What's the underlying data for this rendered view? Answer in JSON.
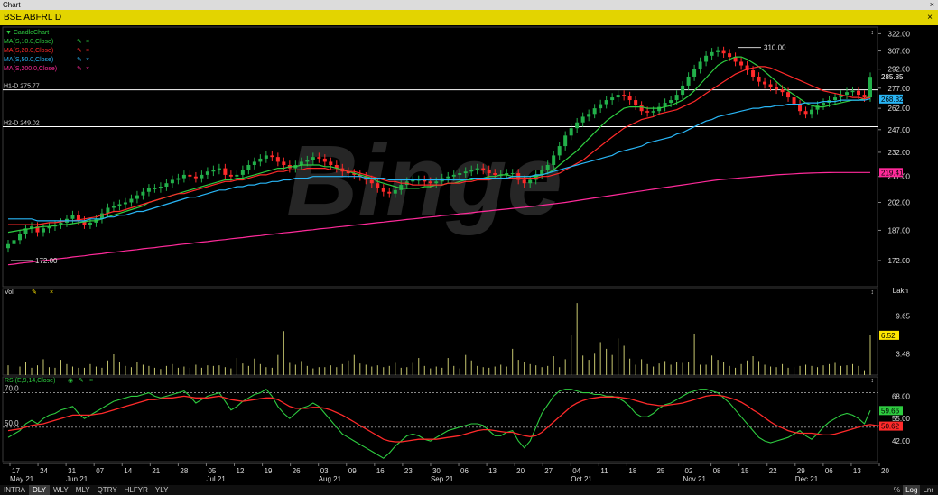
{
  "window": {
    "title": "Chart",
    "close_glyph": "×"
  },
  "symbol_bar": {
    "title": "BSE ABFRL D",
    "close_glyph": "×"
  },
  "legend": {
    "candle": "CandleChart",
    "ma": [
      {
        "label": "MA(S,10.0,Close)",
        "color": "#2ecc40"
      },
      {
        "label": "MA(S,20.0,Close)",
        "color": "#ff2a2a"
      },
      {
        "label": "MA(S,50.0,Close)",
        "color": "#29b6f6"
      },
      {
        "label": "MA(S,200.0,Close)",
        "color": "#ff2a9a"
      }
    ],
    "vol": "Vol",
    "rsi": "RSI(E,9,14,Close)"
  },
  "horizontal_lines": [
    {
      "label": "H1-D 275.77",
      "value": 275.77
    },
    {
      "label": "H2-D 249.02",
      "value": 249.02
    }
  ],
  "annotations": [
    {
      "label": "172.00",
      "value": 172.0
    },
    {
      "label": "310.00",
      "value": 310.0
    }
  ],
  "price_badges": [
    {
      "label": "285.85",
      "value": 285.85,
      "bg": "#000000",
      "fg": "#ffffff"
    },
    {
      "label": "268.82",
      "value": 268.82,
      "bg": "#29b6f6",
      "fg": "#000000"
    },
    {
      "label": "219.41",
      "value": 219.41,
      "bg": "#ff2a9a",
      "fg": "#000000"
    }
  ],
  "volume_unit": "Lakh",
  "volume_badge": {
    "label": "6.52",
    "value": 6.52
  },
  "rsi_badges": [
    {
      "label": "59.66",
      "value": 59.66,
      "bg": "#2ecc40"
    },
    {
      "label": "50.62",
      "value": 50.62,
      "bg": "#ff2a2a"
    }
  ],
  "colors": {
    "up": "#22b04a",
    "down": "#ff2a2a",
    "volume": "#c8c870",
    "watermark": "#262626"
  },
  "timeframes": [
    "INTRA",
    "DLY",
    "WLY",
    "MLY",
    "QTRY",
    "HLFYR",
    "YLY"
  ],
  "active_timeframe": "DLY",
  "scale_toggles": [
    "%",
    "Log",
    "Lnr"
  ],
  "active_scale": "Log",
  "watermark": "Binge",
  "chart_data": {
    "type": "candlestick",
    "title": "BSE ABFRL D",
    "price_axis": {
      "ticks": [
        172.0,
        187.0,
        202.0,
        217.0,
        232.0,
        247.0,
        262.0,
        277.0,
        292.0,
        307.0,
        322.0
      ],
      "ylim": [
        160,
        328
      ],
      "scale": "log"
    },
    "volume_axis": {
      "ticks": [
        3.48,
        9.65
      ],
      "unit": "Lakh",
      "ylim": [
        0,
        13
      ]
    },
    "rsi_axis": {
      "ticks": [
        42.0,
        55.0,
        68.0
      ],
      "ref_lines": [
        70.0,
        50.0
      ],
      "ylim": [
        30,
        75
      ]
    },
    "x_ticks": [
      "17",
      "24",
      "31",
      "07",
      "14",
      "21",
      "28",
      "05",
      "12",
      "19",
      "26",
      "03",
      "09",
      "16",
      "23",
      "30",
      "06",
      "13",
      "20",
      "27",
      "04",
      "11",
      "18",
      "25",
      "02",
      "08",
      "15",
      "22",
      "29",
      "06",
      "13",
      "20"
    ],
    "month_labels": [
      "May 21",
      "Jun 21",
      "Jul 21",
      "Aug 21",
      "Sep 21",
      "Oct 21",
      "Nov 21",
      "Dec 21"
    ],
    "month_tick_index": [
      0,
      2,
      7,
      11,
      15,
      20,
      24,
      28
    ],
    "closes": [
      180,
      182,
      185,
      188,
      189,
      186,
      188,
      189,
      190,
      191,
      193,
      195,
      192,
      190,
      191,
      193,
      196,
      199,
      200,
      201,
      202,
      204,
      206,
      208,
      210,
      210,
      211,
      213,
      215,
      216,
      218,
      217,
      216,
      218,
      220,
      221,
      222,
      218,
      217,
      218,
      221,
      224,
      226,
      228,
      230,
      229,
      226,
      224,
      222,
      224,
      226,
      227,
      229,
      228,
      226,
      224,
      222,
      220,
      219,
      218,
      217,
      215,
      213,
      210,
      208,
      207,
      209,
      212,
      214,
      215,
      215,
      214,
      213,
      214,
      216,
      217,
      218,
      219,
      220,
      221,
      222,
      221,
      219,
      218,
      218,
      219,
      219,
      215,
      213,
      215,
      218,
      221,
      224,
      230,
      236,
      243,
      248,
      252,
      256,
      258,
      262,
      265,
      268,
      270,
      272,
      271,
      268,
      264,
      260,
      259,
      260,
      263,
      266,
      268,
      272,
      279,
      286,
      292,
      298,
      303,
      306,
      307,
      305,
      302,
      298,
      295,
      291,
      286,
      282,
      280,
      278,
      276,
      274,
      270,
      265,
      260,
      258,
      261,
      264,
      266,
      268,
      270,
      272,
      274,
      275,
      272,
      270,
      285.85
    ],
    "ma10": [
      186,
      186.5,
      187,
      187.5,
      188,
      188.5,
      189,
      189,
      189.5,
      190,
      190,
      190.5,
      191,
      191.5,
      192,
      192,
      193,
      194,
      195,
      196,
      197,
      198,
      199,
      200,
      202,
      203,
      204,
      205,
      206,
      207,
      208,
      209,
      210,
      211,
      212,
      213,
      214,
      215,
      215,
      216,
      216,
      217,
      218,
      219,
      220,
      221,
      222,
      222,
      223,
      223,
      224,
      224,
      224,
      224,
      223,
      223,
      222,
      221,
      220,
      219,
      218,
      217,
      216,
      214,
      213,
      212,
      211,
      210,
      210,
      210,
      210,
      211,
      211,
      212,
      212,
      213,
      213,
      214,
      215,
      215,
      216,
      216,
      217,
      217,
      218,
      218,
      217,
      217,
      217,
      217,
      217,
      218,
      219,
      221,
      224,
      227,
      230,
      233,
      237,
      241,
      245,
      249,
      253,
      256,
      259,
      262,
      263,
      263,
      263,
      262,
      262,
      262,
      263,
      264,
      266,
      268,
      271,
      275,
      280,
      285,
      290,
      295,
      298,
      300,
      302,
      302,
      300,
      297,
      294,
      290,
      286,
      282,
      278,
      275,
      272,
      269,
      266,
      264,
      263,
      263,
      264,
      265,
      266,
      267,
      268,
      268,
      269,
      271
    ],
    "ma20": [
      190,
      190,
      190,
      190,
      190,
      190,
      190.5,
      191,
      191,
      191.5,
      192,
      192,
      192.5,
      193,
      193.5,
      194,
      195,
      196,
      197,
      197,
      198,
      199,
      200,
      201,
      202,
      203,
      204,
      205,
      206,
      207,
      207,
      208,
      209,
      210,
      211,
      212,
      213,
      214,
      214,
      215,
      215,
      216,
      217,
      218,
      218,
      219,
      220,
      220,
      221,
      221,
      221,
      222,
      222,
      222,
      222,
      221,
      221,
      221,
      220,
      220,
      219,
      218,
      217,
      216,
      215,
      214,
      214,
      213,
      213,
      212,
      212,
      212,
      212,
      212,
      212,
      213,
      213,
      213,
      214,
      214,
      215,
      215,
      215,
      216,
      216,
      216,
      216,
      216,
      216,
      216,
      216,
      217,
      217,
      218,
      219,
      221,
      223,
      225,
      227,
      230,
      233,
      236,
      239,
      242,
      245,
      248,
      250,
      252,
      254,
      255,
      256,
      258,
      259,
      260,
      261,
      263,
      265,
      267,
      270,
      273,
      276,
      279,
      282,
      285,
      288,
      290,
      292,
      293,
      294,
      294,
      293,
      291,
      289,
      287,
      285,
      283,
      281,
      279,
      277,
      275,
      274,
      273,
      272,
      271,
      270,
      270,
      269,
      270
    ],
    "ma50": [
      193,
      193,
      193,
      193,
      193,
      192,
      192,
      192,
      192,
      192,
      192,
      192,
      192,
      192,
      193,
      193,
      193,
      194,
      194,
      195,
      195,
      196,
      197,
      197,
      198,
      199,
      200,
      201,
      202,
      203,
      204,
      205,
      205,
      206,
      207,
      208,
      209,
      209,
      210,
      211,
      211,
      212,
      212,
      213,
      213,
      214,
      214,
      215,
      215,
      216,
      216,
      216,
      217,
      217,
      217,
      217,
      217,
      217,
      217,
      217,
      217,
      216,
      216,
      216,
      216,
      215,
      215,
      215,
      215,
      215,
      215,
      215,
      215,
      215,
      215,
      215,
      215,
      215,
      215,
      216,
      216,
      216,
      216,
      216,
      216,
      216,
      217,
      217,
      217,
      217,
      218,
      218,
      219,
      220,
      221,
      222,
      223,
      224,
      225,
      226,
      227,
      228,
      229,
      230,
      232,
      233,
      234,
      235,
      236,
      238,
      239,
      240,
      241,
      242,
      244,
      245,
      247,
      249,
      251,
      253,
      254,
      256,
      257,
      258,
      259,
      260,
      261,
      262,
      262,
      263,
      263,
      264,
      264,
      265,
      265,
      265,
      266,
      266,
      266,
      267,
      267,
      267,
      268,
      268,
      268,
      268,
      268,
      269
    ],
    "ma200": [
      170,
      170.3,
      170.7,
      171,
      171.3,
      171.7,
      172,
      172.3,
      172.7,
      173,
      173.3,
      173.7,
      174,
      174.3,
      174.7,
      175,
      175.3,
      175.7,
      176,
      176.3,
      176.7,
      177,
      177.3,
      177.7,
      178,
      178.3,
      178.7,
      179,
      179.3,
      179.7,
      180,
      180.3,
      180.7,
      181,
      181.3,
      181.7,
      182,
      182.3,
      182.7,
      183,
      183.3,
      183.7,
      184,
      184.3,
      184.7,
      185,
      185.3,
      185.7,
      186,
      186.3,
      186.7,
      187,
      187.3,
      187.7,
      188,
      188.3,
      188.7,
      189,
      189.3,
      189.7,
      190,
      190.3,
      190.7,
      191,
      191.3,
      191.7,
      192,
      192.3,
      192.7,
      193,
      193.3,
      193.7,
      194,
      194.3,
      194.7,
      195,
      195.3,
      195.7,
      196,
      196.3,
      196.7,
      197,
      197.3,
      197.7,
      198,
      198.3,
      198.7,
      199,
      199.3,
      199.7,
      200,
      200.4,
      200.8,
      201.2,
      201.6,
      202,
      202.5,
      203,
      203.5,
      204,
      204.5,
      205,
      205.5,
      206,
      206.5,
      207,
      207.5,
      208,
      208.5,
      209,
      209.5,
      210,
      210.5,
      211,
      211.5,
      212,
      212.5,
      213,
      213.5,
      214,
      214.5,
      215,
      215.3,
      215.6,
      215.9,
      216.2,
      216.5,
      216.8,
      217.1,
      217.4,
      217.7,
      218,
      218.2,
      218.4,
      218.6,
      218.8,
      219,
      219.1,
      219.2,
      219.3,
      219.35,
      219.4,
      219.41,
      219.41,
      219.41,
      219.41,
      219.41,
      219.41
    ],
    "volumes": [
      1.6,
      2.2,
      1.4,
      2.1,
      1.2,
      1.6,
      2.6,
      1.3,
      1.2,
      2.5,
      1.8,
      1.4,
      1.2,
      1.2,
      1.8,
      1.4,
      1.2,
      2.4,
      3.4,
      2.1,
      1.5,
      1.3,
      2.2,
      1.7,
      1.5,
      1.2,
      1.0,
      1.5,
      1.8,
      1.2,
      1.4,
      1.2,
      1.7,
      1.2,
      1.6,
      1.5,
      1.6,
      1.3,
      1.1,
      2.8,
      1.9,
      1.5,
      2.7,
      1.8,
      1.3,
      1.2,
      3.3,
      7.2,
      2.0,
      1.7,
      2.3,
      1.5,
      1.1,
      1.3,
      1.3,
      1.6,
      1.3,
      1.8,
      2.4,
      3.3,
      1.9,
      1.7,
      1.4,
      1.6,
      1.3,
      1.5,
      2.0,
      1.2,
      1.3,
      2.0,
      2.8,
      1.5,
      1.1,
      1.4,
      1.2,
      2.8,
      1.5,
      1.1,
      3.3,
      2.4,
      1.5,
      1.3,
      1.2,
      1.4,
      1.7,
      1.4,
      4.3,
      2.5,
      2.2,
      1.8,
      1.6,
      1.3,
      1.5,
      3.1,
      1.3,
      2.6,
      6.6,
      11.8,
      3.2,
      2.5,
      3.5,
      5.4,
      4.3,
      3.3,
      6.0,
      4.8,
      2.7,
      1.7,
      2.6,
      1.8,
      1.4,
      1.9,
      2.3,
      1.7,
      2.2,
      2.0,
      2.1,
      6.8,
      1.7,
      1.7,
      3.2,
      2.5,
      2.2,
      1.5,
      1.2,
      1.8,
      2.4,
      3.1,
      2.3,
      1.7,
      1.4,
      1.3,
      1.8,
      1.2,
      1.3,
      1.5,
      1.7,
      1.5,
      1.3,
      1.6,
      1.8,
      2.0,
      1.5,
      1.6,
      1.8,
      1.5,
      0.8,
      6.52
    ],
    "rsi": [
      44,
      46,
      48,
      52,
      54,
      52,
      55,
      57,
      58,
      60,
      61,
      62,
      58,
      55,
      57,
      59,
      61,
      63,
      65,
      66,
      67,
      68,
      68,
      69,
      70,
      68,
      67,
      68,
      69,
      70,
      71,
      68,
      64,
      66,
      68,
      69,
      70,
      65,
      60,
      62,
      65,
      67,
      69,
      70,
      72,
      68,
      62,
      58,
      55,
      58,
      61,
      62,
      64,
      62,
      58,
      54,
      50,
      46,
      44,
      42,
      40,
      38,
      36,
      34,
      32,
      35,
      39,
      42,
      45,
      46,
      45,
      43,
      42,
      44,
      46,
      48,
      49,
      50,
      51,
      52,
      52,
      51,
      48,
      45,
      45,
      47,
      48,
      42,
      38,
      42,
      50,
      58,
      63,
      68,
      71,
      72,
      72,
      71,
      70,
      70,
      69,
      69,
      68,
      68,
      67,
      65,
      62,
      58,
      56,
      56,
      58,
      61,
      63,
      64,
      66,
      68,
      70,
      71,
      72,
      72,
      71,
      70,
      67,
      64,
      60,
      56,
      52,
      48,
      44,
      42,
      41,
      42,
      43,
      44,
      46,
      48,
      45,
      43,
      46,
      50,
      53,
      55,
      57,
      58,
      57,
      55,
      52,
      59.66
    ],
    "rsi_signal": [
      48,
      48.5,
      49,
      50,
      51,
      51.5,
      52,
      53,
      54,
      55,
      56,
      57,
      57,
      57,
      57,
      57.5,
      58,
      59,
      60,
      61,
      62,
      63,
      64,
      65,
      66,
      66,
      66.5,
      67,
      67,
      67.5,
      68,
      67.5,
      67,
      67,
      67,
      67.5,
      68,
      67,
      66,
      65.5,
      65,
      65.5,
      66,
      66.5,
      67,
      67,
      66,
      64,
      62,
      61,
      61,
      61,
      61.5,
      61.5,
      61,
      60,
      58.5,
      57,
      55,
      53,
      51,
      49,
      47,
      45,
      43,
      42,
      41.5,
      41.5,
      42,
      42.5,
      43,
      43,
      43,
      43,
      43.5,
      44,
      44.5,
      45,
      46,
      47,
      48,
      48.5,
      48.5,
      48,
      47.5,
      47,
      47,
      46,
      45,
      44.5,
      45,
      47,
      50,
      53,
      56,
      59,
      62,
      64,
      65.5,
      66.5,
      67,
      67.5,
      67.5,
      67.5,
      67.5,
      67,
      66.5,
      65.5,
      64.5,
      63.5,
      63,
      62.5,
      62.5,
      63,
      63.5,
      64,
      65,
      66,
      67,
      68,
      68.5,
      68.5,
      68,
      67,
      66,
      64.5,
      62.5,
      60,
      58,
      55.5,
      53,
      51,
      49.5,
      48,
      47,
      46.5,
      46.5,
      46.5,
      46,
      45.5,
      45.5,
      46,
      47,
      48,
      49,
      50,
      51,
      51.5,
      51,
      50.62
    ]
  }
}
